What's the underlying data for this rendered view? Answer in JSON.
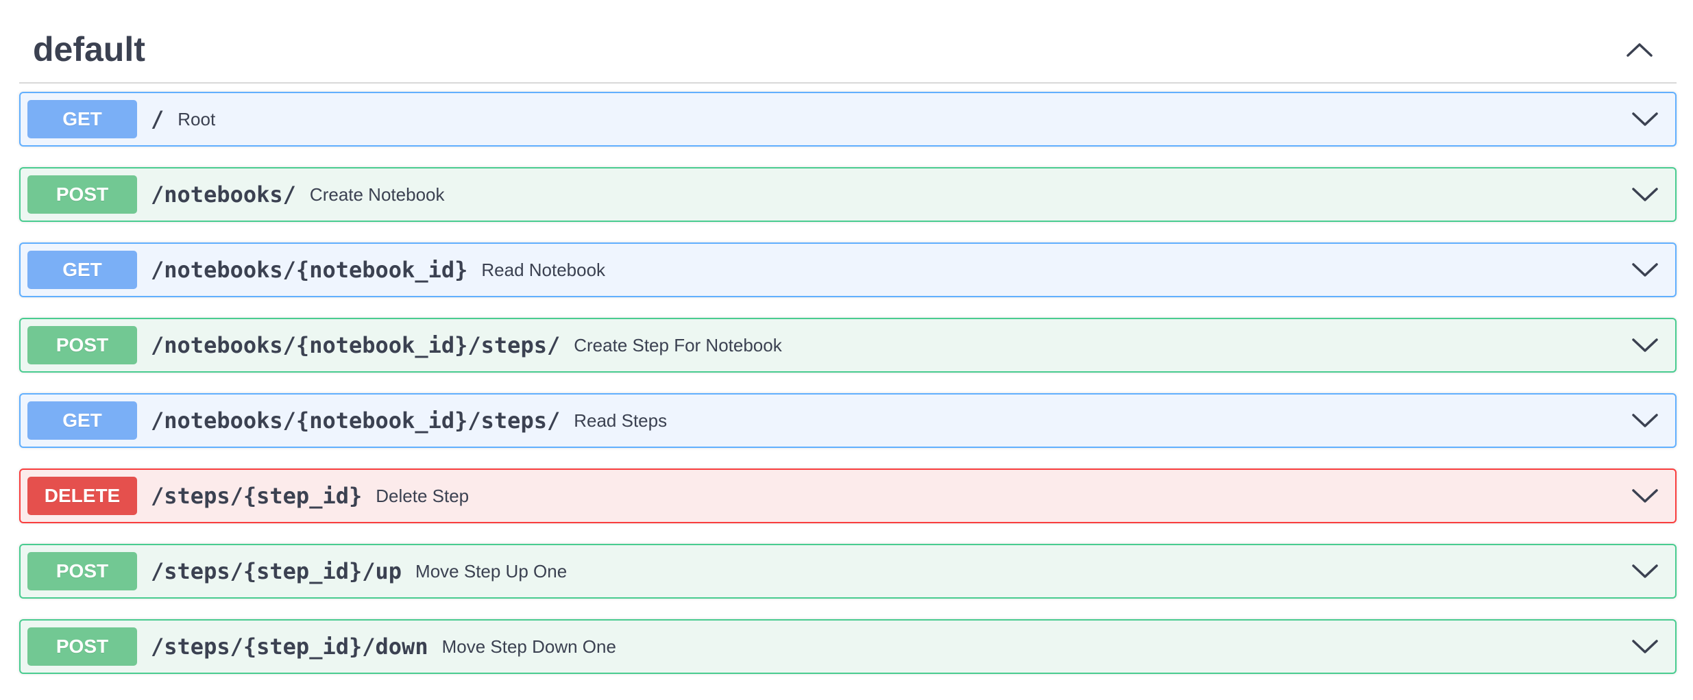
{
  "section": {
    "title": "default",
    "toggle_icon": "chevron-up-icon"
  },
  "operations": [
    {
      "method": "GET",
      "path": "/",
      "summary": "Root",
      "color": "#61affe"
    },
    {
      "method": "POST",
      "path": "/notebooks/",
      "summary": "Create Notebook",
      "color": "#49cc90"
    },
    {
      "method": "GET",
      "path": "/notebooks/{notebook_id}",
      "summary": "Read Notebook",
      "color": "#61affe"
    },
    {
      "method": "POST",
      "path": "/notebooks/{notebook_id}/steps/",
      "summary": "Create Step For Notebook",
      "color": "#49cc90"
    },
    {
      "method": "GET",
      "path": "/notebooks/{notebook_id}/steps/",
      "summary": "Read Steps",
      "color": "#61affe"
    },
    {
      "method": "DELETE",
      "path": "/steps/{step_id}",
      "summary": "Delete Step",
      "color": "#f93e3e"
    },
    {
      "method": "POST",
      "path": "/steps/{step_id}/up",
      "summary": "Move Step Up One",
      "color": "#49cc90"
    },
    {
      "method": "POST",
      "path": "/steps/{step_id}/down",
      "summary": "Move Step Down One",
      "color": "#49cc90"
    }
  ],
  "expand_icon": "chevron-down-icon"
}
